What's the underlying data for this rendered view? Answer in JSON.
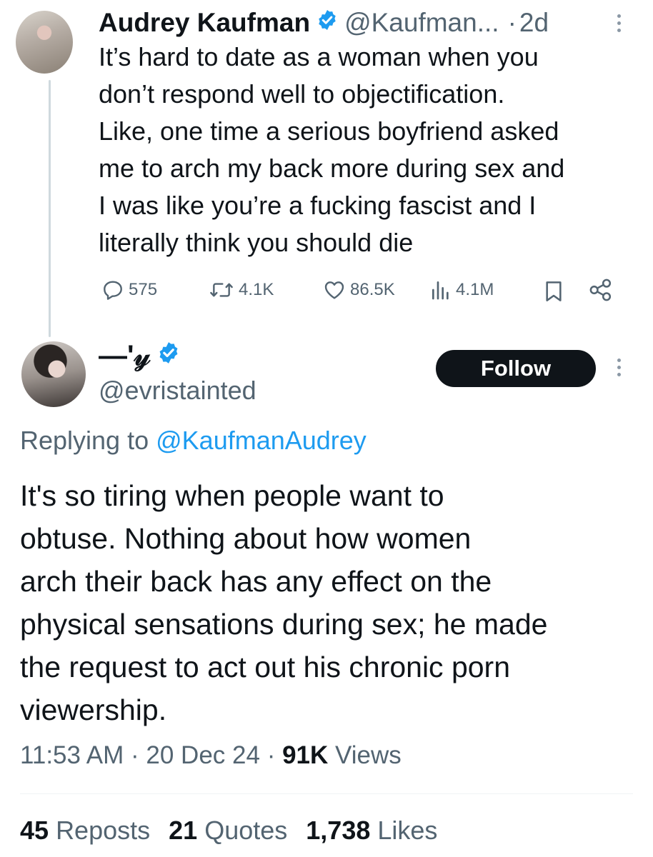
{
  "parent_tweet": {
    "author_name": "Audrey Kaufman",
    "handle": "@Kaufman...",
    "separator": "·",
    "time": "2d",
    "text": "It’s hard to date as a woman when you\ndon’t respond well to objectification.\nLike, one time a serious boyfriend asked\nme to arch my back more during sex and\nI was like you’re a fucking fascist and I\nliterally think you should die",
    "actions": {
      "replies": "575",
      "reposts": "4.1K",
      "likes": "86.5K",
      "views": "4.1M"
    },
    "icons": [
      "verified-badge-icon",
      "more-icon",
      "reply-icon",
      "repost-icon",
      "like-icon",
      "views-icon",
      "bookmark-icon",
      "share-icon"
    ]
  },
  "reply_tweet": {
    "author_name": "—ʹ𝓎",
    "handle": "@evristainted",
    "follow_label": "Follow",
    "replying_prefix": "Replying to ",
    "replying_to": "@KaufmanAudrey",
    "text": "It's so tiring when people want to\nobtuse. Nothing about how women\narch their back has any effect on the\nphysical sensations during sex; he made\nthe request to act out his chronic porn\nviewership.",
    "time": "11:53 AM",
    "date": "20 Dec 24",
    "meta_separator": "·",
    "views_count": "91K",
    "views_label": "Views",
    "stats": {
      "reposts_count": "45",
      "reposts_label": "Reposts",
      "quotes_count": "21",
      "quotes_label": "Quotes",
      "likes_count": "1,738",
      "likes_label": "Likes"
    }
  },
  "colors": {
    "text": "#0f1419",
    "secondary": "#536471",
    "link": "#1d9bf0",
    "verified": "#1d9bf0",
    "divider": "#eff3f4",
    "thread_line": "#cfd9de",
    "follow_bg": "#0f1419"
  }
}
